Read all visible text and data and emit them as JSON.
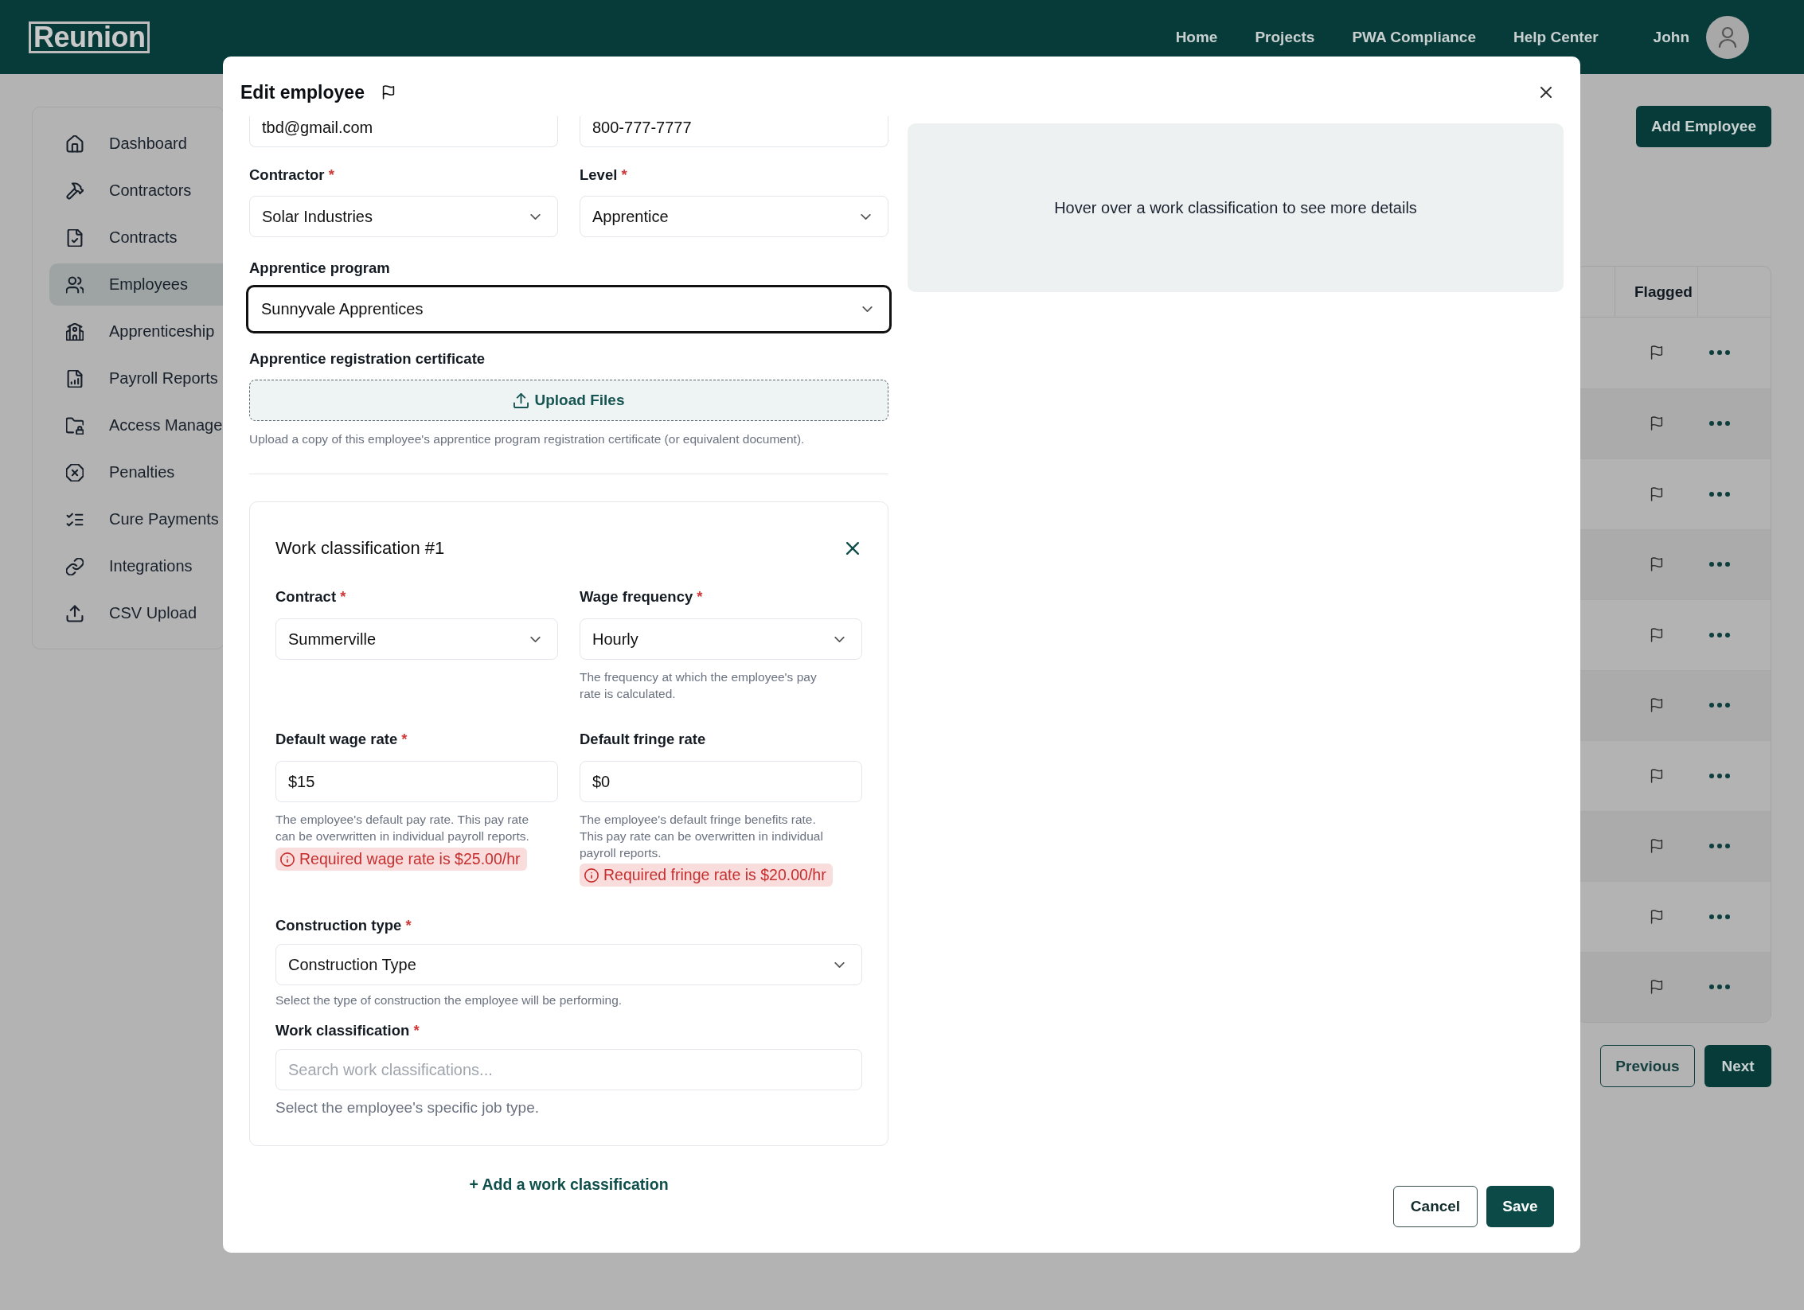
{
  "top_bar": {
    "logo": "Reunion",
    "nav": [
      "Home",
      "Projects",
      "PWA Compliance",
      "Help Center"
    ],
    "user_name": "John"
  },
  "sidebar": {
    "items": [
      {
        "label": "Dashboard",
        "selected": false
      },
      {
        "label": "Contractors",
        "selected": false
      },
      {
        "label": "Contracts",
        "selected": false
      },
      {
        "label": "Employees",
        "selected": true
      },
      {
        "label": "Apprenticeship",
        "selected": false
      },
      {
        "label": "Payroll Reports",
        "selected": false
      },
      {
        "label": "Access Manage",
        "selected": false
      },
      {
        "label": "Penalties",
        "selected": false
      },
      {
        "label": "Cure Payments",
        "selected": false
      },
      {
        "label": "Integrations",
        "selected": false
      },
      {
        "label": "CSV Upload",
        "selected": false
      }
    ]
  },
  "page": {
    "add_button": "Add Employee",
    "table": {
      "columns": [
        "Flagged"
      ],
      "rows": [
        {
          "flagged": false
        },
        {
          "flagged": false
        },
        {
          "flagged": false
        },
        {
          "flagged": false
        },
        {
          "flagged": false
        },
        {
          "flagged": false
        },
        {
          "flagged": false
        },
        {
          "flagged": false
        },
        {
          "flagged": false
        },
        {
          "flagged": false
        }
      ]
    },
    "pagination": {
      "previous": "Previous",
      "next": "Next"
    }
  },
  "modal": {
    "title": "Edit employee",
    "flagged": false,
    "contact_fields": [
      {
        "value": "tbd@gmail.com"
      },
      {
        "value": "800-777-7777"
      }
    ],
    "contractor": {
      "label": "Contractor",
      "required_mark": "*",
      "value": "Solar Industries"
    },
    "level": {
      "label": "Level",
      "required_mark": "*",
      "value": "Apprentice"
    },
    "apprentice_program": {
      "label": "Apprentice program",
      "value": "Sunnyvale Apprentices",
      "focused": true
    },
    "certificate": {
      "label": "Apprentice registration certificate",
      "upload_button": "Upload Files",
      "help": "Upload a copy of this employee's apprentice program registration certificate (or equivalent document)."
    },
    "details_panel": {
      "text": "Hover over a work classification to see more details"
    },
    "work_classifications": [
      {
        "title": "Work classification #1",
        "contract": {
          "label": "Contract",
          "required_mark": "*",
          "value": "Summerville"
        },
        "wage_frequency": {
          "label": "Wage frequency",
          "required_mark": "*",
          "value": "Hourly",
          "help": "The frequency at which the employee's pay rate is calculated."
        },
        "default_wage_rate": {
          "label": "Default wage rate",
          "required_mark": "*",
          "value": "$15",
          "help": "The employee's default pay rate. This pay rate can be overwritten in individual payroll reports.",
          "error": "Required wage rate is $25.00/hr"
        },
        "default_fringe_rate": {
          "label": "Default fringe rate",
          "value": "$0",
          "help": "The employee's default fringe benefits rate. This pay rate can be overwritten in individual payroll reports.",
          "error": "Required fringe rate is $20.00/hr"
        },
        "construction_type": {
          "label": "Construction type",
          "required_mark": "*",
          "value": "Construction Type",
          "help": "Select the type of construction the employee will be performing."
        },
        "work_classification": {
          "label": "Work classification",
          "required_mark": "*",
          "placeholder": "Search work classifications...",
          "help": "Select the employee's specific job type."
        }
      }
    ],
    "add_classification": "+ Add a work classification",
    "buttons": {
      "cancel": "Cancel",
      "save": "Save"
    }
  }
}
